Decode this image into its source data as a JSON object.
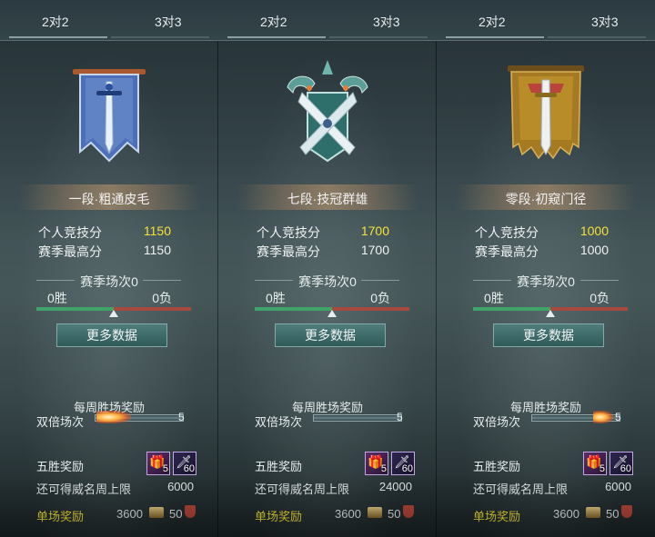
{
  "panels": [
    {
      "tabs": [
        "2对2",
        "3对3"
      ],
      "emblem": "blue-banner-sword-emblem",
      "rank_title": "一段·粗通皮毛",
      "personal_score_label": "个人竞技分",
      "personal_score_value": "1150",
      "season_high_label": "赛季最高分",
      "season_high_value": "1150",
      "season_matches": "赛季场次0",
      "wins": "0胜",
      "losses": "0负",
      "more_button": "更多数据",
      "weekly_title": "每周胜场奖励",
      "double_label": "双倍场次",
      "double_count": "5",
      "five_win_label": "五胜奖励",
      "items": [
        {
          "icon": "chest-icon",
          "count": "5"
        },
        {
          "icon": "sword-icon",
          "count": "60"
        }
      ],
      "prestige_label": "还可得威名周上限",
      "prestige_value": "6000",
      "single_label": "单场奖励",
      "coin_value": "3600",
      "shield_value": "50"
    },
    {
      "tabs": [
        "2对2",
        "3对3"
      ],
      "emblem": "teal-crossed-swords-emblem",
      "rank_title": "七段·技冠群雄",
      "personal_score_label": "个人竞技分",
      "personal_score_value": "1700",
      "season_high_label": "赛季最高分",
      "season_high_value": "1700",
      "season_matches": "赛季场次0",
      "wins": "0胜",
      "losses": "0负",
      "more_button": "更多数据",
      "weekly_title": "每周胜场奖励",
      "double_label": "双倍场次",
      "double_count": "5",
      "five_win_label": "五胜奖励",
      "items": [
        {
          "icon": "chest-icon",
          "count": "5"
        },
        {
          "icon": "sword-icon",
          "count": "60"
        }
      ],
      "prestige_label": "还可得威名周上限",
      "prestige_value": "24000",
      "single_label": "单场奖励",
      "coin_value": "3600",
      "shield_value": "50"
    },
    {
      "tabs": [
        "2对2",
        "3对3"
      ],
      "emblem": "gold-banner-sword-emblem",
      "rank_title": "零段·初窥门径",
      "personal_score_label": "个人竞技分",
      "personal_score_value": "1000",
      "season_high_label": "赛季最高分",
      "season_high_value": "1000",
      "season_matches": "赛季场次0",
      "wins": "0胜",
      "losses": "0负",
      "more_button": "更多数据",
      "weekly_title": "每周胜场奖励",
      "double_label": "双倍场次",
      "double_count": "5",
      "five_win_label": "五胜奖励",
      "items": [
        {
          "icon": "chest-icon",
          "count": "5"
        },
        {
          "icon": "sword-icon",
          "count": "60"
        }
      ],
      "prestige_label": "还可得威名周上限",
      "prestige_value": "6000",
      "single_label": "单场奖励",
      "coin_value": "3600",
      "shield_value": "50"
    }
  ],
  "colors": {
    "gold_text": "#f2e23a",
    "win_bar": "#3fa36b",
    "loss_bar": "#a64a3d",
    "button": "#3f6b69"
  },
  "win_fraction": 0.5
}
